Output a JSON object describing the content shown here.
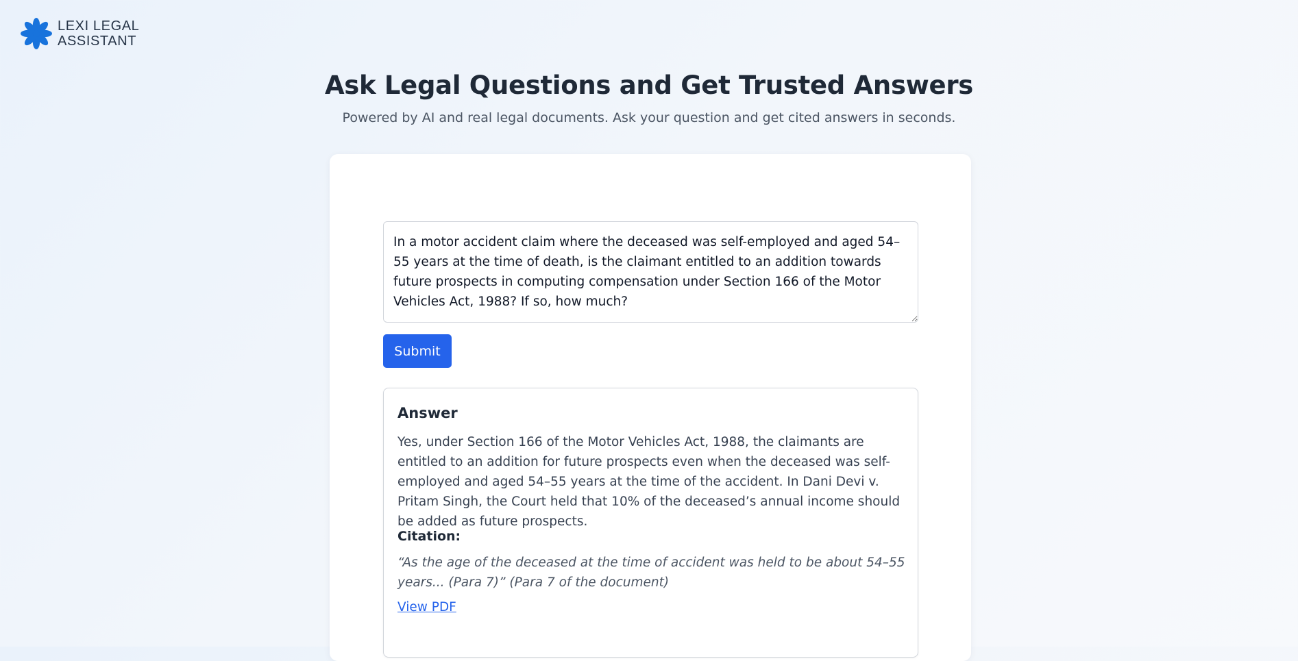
{
  "app": {
    "logo_line1": "LEXI LEGAL",
    "logo_line2": "ASSISTANT",
    "logo_icon": "asterisk-flower-icon",
    "brand_color": "#1873dc"
  },
  "header": {
    "title": "Ask Legal Questions and Get Trusted Answers",
    "subtitle": "Powered by AI and real legal documents. Ask your question and get cited answers in seconds."
  },
  "question": {
    "value": "In a motor accident claim where the deceased was self-employed and aged 54–55 years at the time of death, is the claimant entitled to an addition towards future prospects in computing compensation under Section 166 of the Motor Vehicles Act, 1988? If so, how much?",
    "placeholder": ""
  },
  "submit": {
    "label": "Submit",
    "color": "#2563eb"
  },
  "answer": {
    "heading": "Answer",
    "text": "Yes, under Section 166 of the Motor Vehicles Act, 1988, the claimants are entitled to an addition for future prospects even when the deceased was self-employed and aged 54–55 years at the time of the accident. In Dani Devi v. Pritam Singh, the Court held that 10% of the deceased’s annual income should be added as future prospects.",
    "citation_heading": "Citation:",
    "citation_text": "“As the age of the deceased at the time of accident was held to be about 54–55 years... (Para 7)” (Para 7 of the document)",
    "link_label": "View PDF"
  }
}
